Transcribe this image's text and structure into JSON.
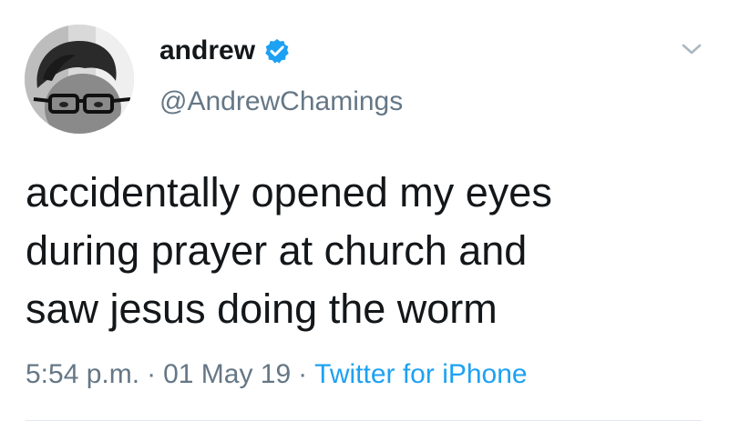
{
  "tweet": {
    "display_name": "andrew",
    "handle": "@AndrewChamings",
    "text_lines": [
      "accidentally opened my eyes",
      "during prayer at church and",
      "saw jesus doing the worm"
    ],
    "time": "5:54 p.m.",
    "separator": "·",
    "date": "01 May 19",
    "source": "Twitter for iPhone"
  },
  "icons": {
    "verified": "verified-badge-icon",
    "menu": "chevron-down-icon"
  },
  "colors": {
    "text": "#14171a",
    "muted": "#657786",
    "accent": "#1da1f2",
    "divider": "#e1e8ed"
  }
}
